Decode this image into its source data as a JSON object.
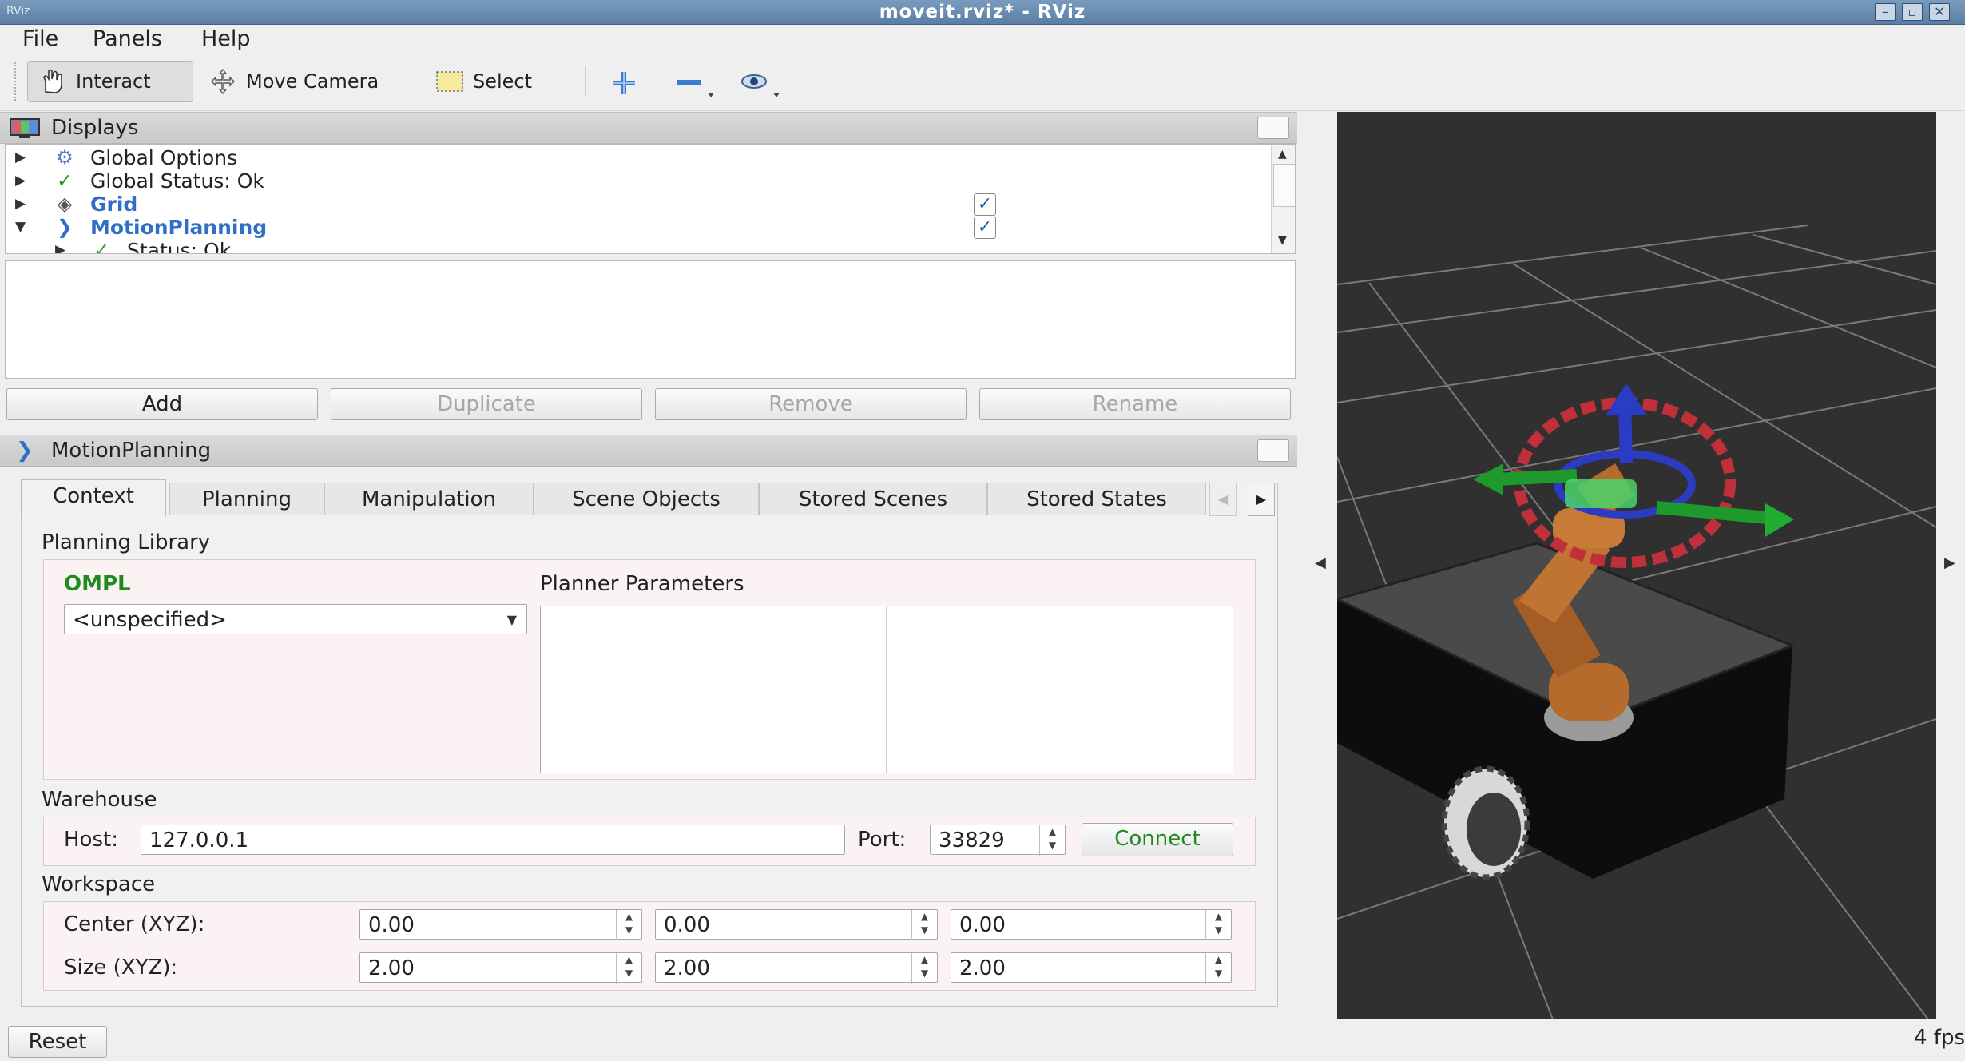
{
  "window": {
    "app_icon": "RViz",
    "title": "moveit.rviz* - RViz",
    "controls": [
      "minimize-icon",
      "maximize-icon",
      "close-icon"
    ]
  },
  "menubar": {
    "items": [
      {
        "label": "File"
      },
      {
        "label": "Panels"
      },
      {
        "label": "Help"
      }
    ]
  },
  "toolbar": {
    "interact": "Interact",
    "move_camera": "Move Camera",
    "select": "Select",
    "icons": [
      "hand-icon",
      "camera-move-icon",
      "select-rect-icon",
      "plus-crosshair-icon",
      "minus-icon",
      "eye-icon"
    ]
  },
  "displays": {
    "title": "Displays",
    "tree": [
      {
        "label": "Global Options",
        "icon": "gear-icon",
        "checked": null
      },
      {
        "label": "Global Status: Ok",
        "icon": "check-icon",
        "checked": null
      },
      {
        "label": "Grid",
        "icon": "grid-icon",
        "checked": true
      },
      {
        "label": "MotionPlanning",
        "icon": "motionplanning-icon",
        "checked": true
      },
      {
        "label": "Status: Ok",
        "icon": "check-icon",
        "checked": null
      }
    ],
    "buttons": {
      "add": "Add",
      "duplicate": "Duplicate",
      "remove": "Remove",
      "rename": "Rename"
    }
  },
  "motion_planning": {
    "title": "MotionPlanning",
    "tabs": [
      "Context",
      "Planning",
      "Manipulation",
      "Scene Objects",
      "Stored Scenes",
      "Stored States"
    ],
    "active_tab": "Context",
    "planning_library": {
      "label": "Planning Library",
      "library_name": "OMPL",
      "planner_select": "<unspecified>",
      "params_label": "Planner Parameters"
    },
    "warehouse": {
      "label": "Warehouse",
      "host_label": "Host:",
      "host": "127.0.0.1",
      "port_label": "Port:",
      "port": "33829",
      "connect": "Connect"
    },
    "workspace": {
      "label": "Workspace",
      "center_label": "Center (XYZ):",
      "size_label": "Size (XYZ):",
      "center": [
        "0.00",
        "0.00",
        "0.00"
      ],
      "size": [
        "2.00",
        "2.00",
        "2.00"
      ]
    }
  },
  "statusbar": {
    "reset": "Reset",
    "fps": "4 fps"
  },
  "colors": {
    "accent_blue": "#2f6fc6",
    "ompl_green": "#1f8a1f",
    "connect_green": "#1f8a1f",
    "view_bg": "#303030"
  }
}
